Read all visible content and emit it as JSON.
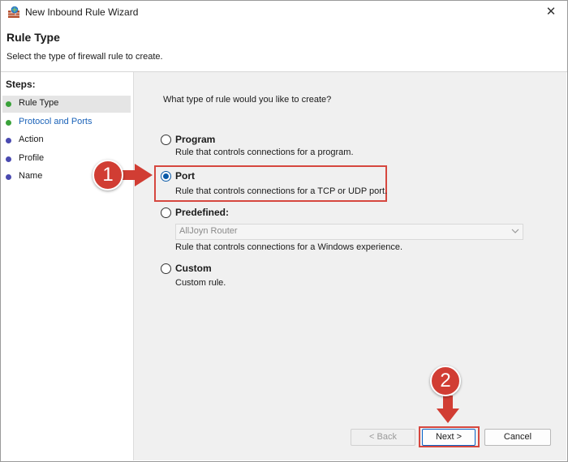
{
  "window": {
    "title": "New Inbound Rule Wizard",
    "app_icon": "firewall-icon",
    "close_glyph": "✕"
  },
  "header": {
    "title": "Rule Type",
    "subtitle": "Select the type of firewall rule to create."
  },
  "steps": {
    "heading": "Steps:",
    "items": [
      {
        "label": "Rule Type",
        "status": "green",
        "selected": true
      },
      {
        "label": "Protocol and Ports",
        "status": "green",
        "selected": false
      },
      {
        "label": "Action",
        "status": "blue",
        "selected": false
      },
      {
        "label": "Profile",
        "status": "blue",
        "selected": false
      },
      {
        "label": "Name",
        "status": "blue",
        "selected": false
      }
    ]
  },
  "content": {
    "question": "What type of rule would you like to create?",
    "options": [
      {
        "label": "Program",
        "description": "Rule that controls connections for a program.",
        "checked": false
      },
      {
        "label": "Port",
        "description": "Rule that controls connections for a TCP or UDP port.",
        "checked": true
      },
      {
        "label": "Predefined:",
        "description": "Rule that controls connections for a Windows experience.",
        "checked": false
      },
      {
        "label": "Custom",
        "description": "Custom rule.",
        "checked": false
      }
    ],
    "predefined_dropdown": {
      "value": "AllJoyn Router",
      "enabled": false
    }
  },
  "buttons": {
    "back": "< Back",
    "next": "Next >",
    "cancel": "Cancel"
  },
  "annotations": {
    "marker_1": "1",
    "marker_2": "2"
  },
  "colors": {
    "accent": "#0a5aa8",
    "highlight": "#d6473f",
    "marker": "#d13d33",
    "step_done": "#3aa23a",
    "step_pending": "#4a4ab0",
    "step_link": "#1a62b8",
    "pane_background": "#f0f0f0"
  }
}
